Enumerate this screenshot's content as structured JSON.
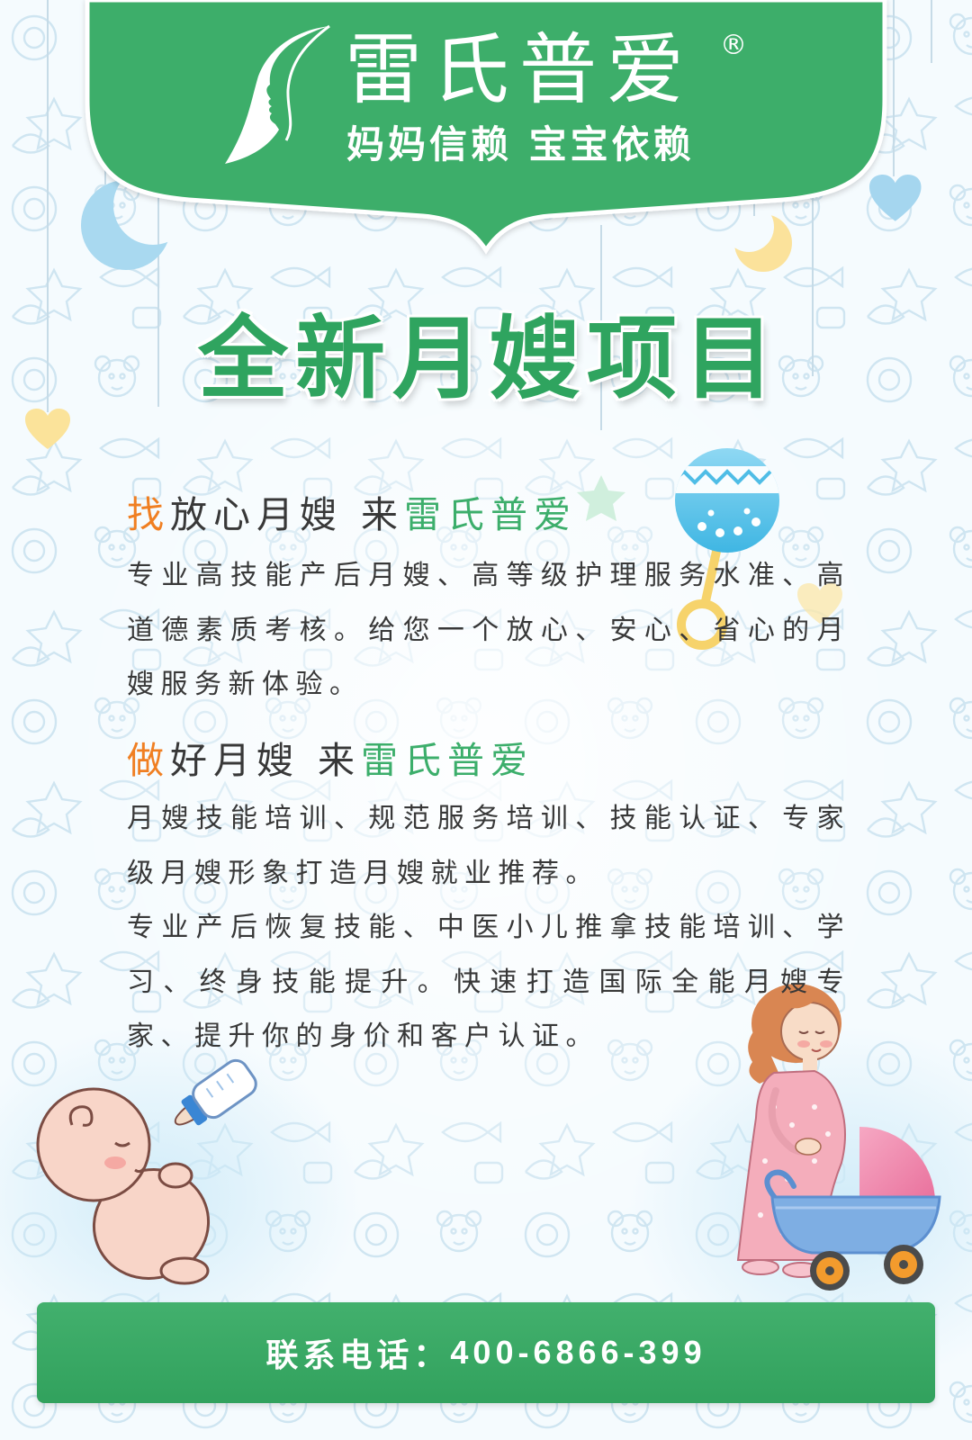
{
  "brand": {
    "name": "雷氏普爱",
    "registered_mark": "®",
    "tagline": "妈妈信赖 宝宝依赖",
    "logo_icon": "leaf-face-logo-icon"
  },
  "title": "全新月嫂项目",
  "sections": [
    {
      "heading": {
        "lead": "找",
        "middle": "放心月嫂 来",
        "brand": "雷氏普爱"
      },
      "paragraphs": [
        [
          "专业高技能产后月嫂、高等级护理服务水准、高",
          "道德素质考核。给您一个放心、安心、省心的月",
          "嫂服务新体验。"
        ]
      ]
    },
    {
      "heading": {
        "lead": "做",
        "middle": "好月嫂 来",
        "brand": "雷氏普爱"
      },
      "paragraphs": [
        [
          "月嫂技能培训、规范服务培训、技能认证、专家",
          "级月嫂形象打造月嫂就业推荐。"
        ],
        [
          "专业产后恢复技能、中医小儿推拿技能培训、学",
          "习、终身技能提升。快速打造国际全能月嫂专",
          "家、提升你的身价和客户认证。"
        ]
      ]
    }
  ],
  "contact": {
    "label": "联系电话：",
    "phone": "400-6866-399"
  },
  "colors": {
    "brand_green": "#3cae6b",
    "title_green": "#2fa45f",
    "accent_orange": "#f07f22",
    "text_dark": "#383838",
    "contact_green": "#34aa62",
    "banner_text": "#ffffff"
  },
  "decorations": [
    "moon-icon",
    "heart-icon",
    "star-icon",
    "rattle-icon",
    "baby-illustration",
    "baby-bottle-icon",
    "mother-illustration",
    "stroller-icon"
  ]
}
